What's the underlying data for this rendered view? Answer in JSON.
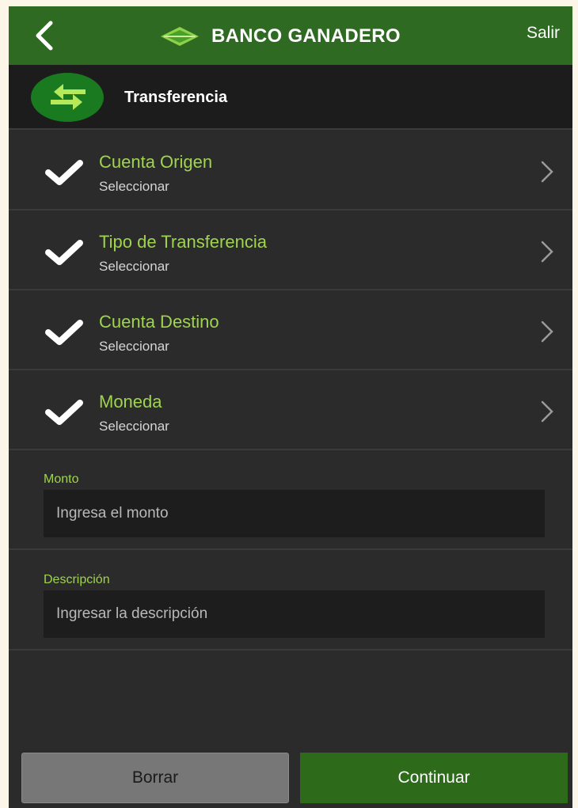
{
  "header": {
    "brand": "BANCO GANADERO",
    "exit_label": "Salir",
    "back_icon": "chevron-left-icon",
    "logo_icon": "banco-ganadero-logo-icon"
  },
  "screen": {
    "title": "Transferencia",
    "title_icon": "transfer-arrows-icon"
  },
  "selections": [
    {
      "label": "Cuenta Origen",
      "value": "Seleccionar"
    },
    {
      "label": "Tipo de Transferencia",
      "value": "Seleccionar"
    },
    {
      "label": "Cuenta Destino",
      "value": "Seleccionar"
    },
    {
      "label": "Moneda",
      "value": "Seleccionar"
    }
  ],
  "fields": {
    "amount": {
      "label": "Monto",
      "placeholder": "Ingresa el monto"
    },
    "description": {
      "label": "Descripción",
      "placeholder": "Ingresar la descripción"
    }
  },
  "actions": {
    "clear_label": "Borrar",
    "continue_label": "Continuar"
  },
  "colors": {
    "header_bg": "#2e6a22",
    "accent_green": "#9ed44e",
    "continue_bg": "#2d6a1a",
    "clear_bg": "#777777",
    "background": "#2b2b2b"
  }
}
